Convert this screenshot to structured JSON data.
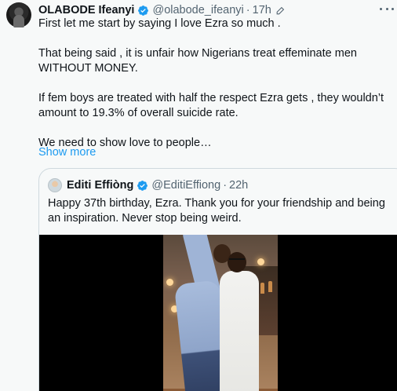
{
  "tweet": {
    "author_name": "OLABODE Ifeanyi",
    "author_handle": "@olabode_ifeanyi",
    "separator": "·",
    "time": "17h",
    "lines": [
      "First let me start by saying I love Ezra so much .",
      "That being said , it is unfair how Nigerians treat effeminate men WITHOUT MONEY.",
      "If  fem boys are treated with half the respect Ezra gets , they wouldn’t amount to 19.3% of overall suicide rate.",
      "We need to show love to people…"
    ],
    "show_more_label": "Show more"
  },
  "quoted_tweet": {
    "author_name": "Editi Effiòng",
    "author_handle": "@EditiEffiong",
    "separator": "·",
    "time": "22h",
    "text": "Happy 37th birthday, Ezra. Thank you for your friendship and being an inspiration. Never stop being weird."
  },
  "icons": {
    "verified": "verified-badge-icon",
    "edited": "pencil-edit-icon",
    "more": "more-options-icon"
  },
  "colors": {
    "accent": "#1d9bf0",
    "secondary_text": "#536471",
    "border": "#cfd9de",
    "background": "#f7f9f9"
  }
}
